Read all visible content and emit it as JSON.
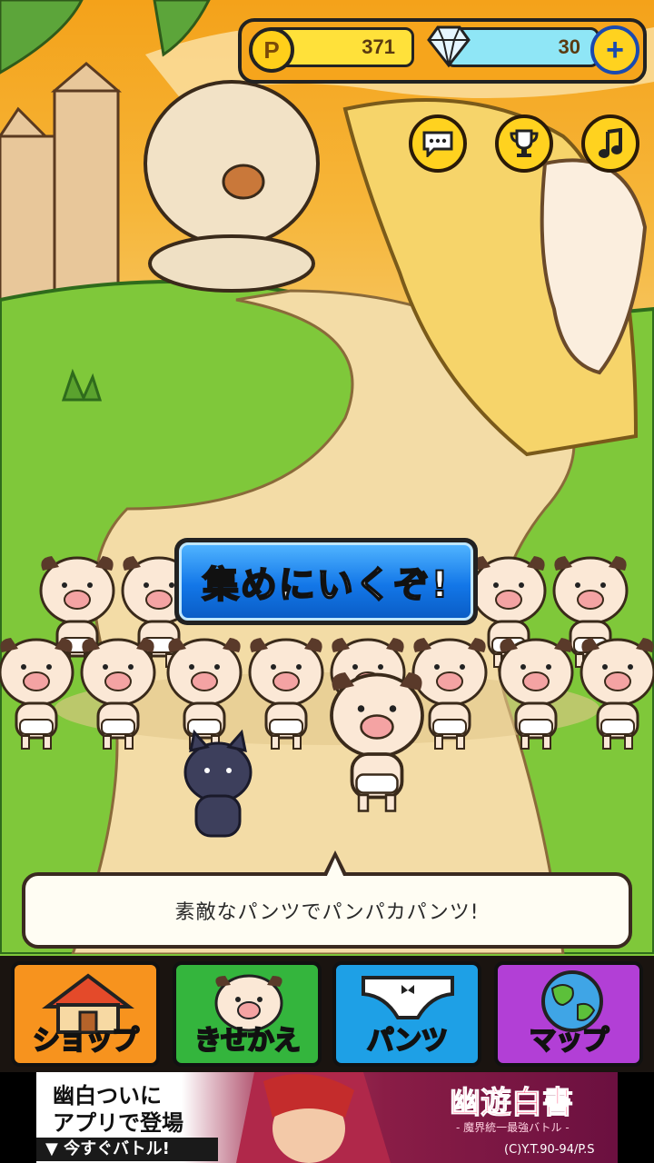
{
  "hud": {
    "points_value": "371",
    "gems_value": "30",
    "plus_label": "+",
    "points_icon_letter": "P"
  },
  "icons": {
    "points": "p-coin-icon",
    "gem": "diamond-icon",
    "plus": "plus-icon",
    "chat": "chat-bubble-icon",
    "trophy": "trophy-icon",
    "music": "music-note-icon"
  },
  "main": {
    "go_collect_label": "集めにいくぞ!",
    "dialog_text": "素敵なパンツでパンパカパンツ!"
  },
  "nav": {
    "items": [
      {
        "label": "ショップ",
        "color": "#f7931e"
      },
      {
        "label": "きせかえ",
        "color": "#34b53d"
      },
      {
        "label": "パンツ",
        "color": "#1ea0e6"
      },
      {
        "label": "マップ",
        "color": "#b23fd6"
      }
    ]
  },
  "ad": {
    "line1": "幽白ついに",
    "line2": "アプリで登場",
    "line3": "▼ 今すぐバトル!",
    "logo": "幽遊白書",
    "subtitle": "- 魔界統一最強バトル -",
    "copyright": "(C)Y.T.90-94/P.S"
  },
  "colors": {
    "accent": "#1377e8",
    "hud_bg": "#f6a51c",
    "grass": "#7fc83a"
  }
}
